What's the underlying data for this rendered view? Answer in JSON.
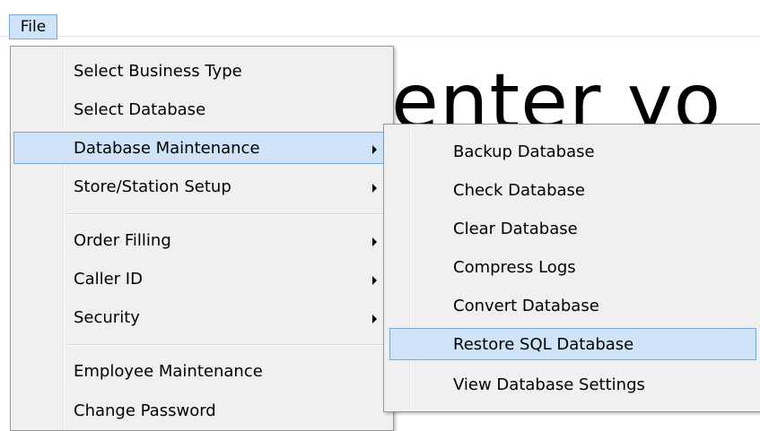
{
  "menubar": {
    "file_label": "File"
  },
  "background": {
    "partial_text": "enter yo"
  },
  "file_menu": {
    "items": [
      {
        "label": "Select Business Type",
        "submenu": false
      },
      {
        "label": "Select Database",
        "submenu": false
      },
      {
        "label": "Database Maintenance",
        "submenu": true,
        "highlighted": true
      },
      {
        "label": "Store/Station Setup",
        "submenu": true
      },
      {
        "label": "Order Filling",
        "submenu": true
      },
      {
        "label": "Caller ID",
        "submenu": true
      },
      {
        "label": "Security",
        "submenu": true
      },
      {
        "label": "Employee Maintenance",
        "submenu": false
      },
      {
        "label": "Change Password",
        "submenu": false
      }
    ]
  },
  "database_maintenance_menu": {
    "items": [
      {
        "label": "Backup Database"
      },
      {
        "label": "Check Database"
      },
      {
        "label": "Clear Database"
      },
      {
        "label": "Compress Logs"
      },
      {
        "label": "Convert Database"
      },
      {
        "label": "Restore SQL Database",
        "highlighted": true
      },
      {
        "label": "View Database Settings"
      }
    ]
  },
  "colors": {
    "highlight_fill": "#cfe4f8",
    "highlight_border": "#7aa7d8",
    "menu_background": "#f0f0f0"
  }
}
